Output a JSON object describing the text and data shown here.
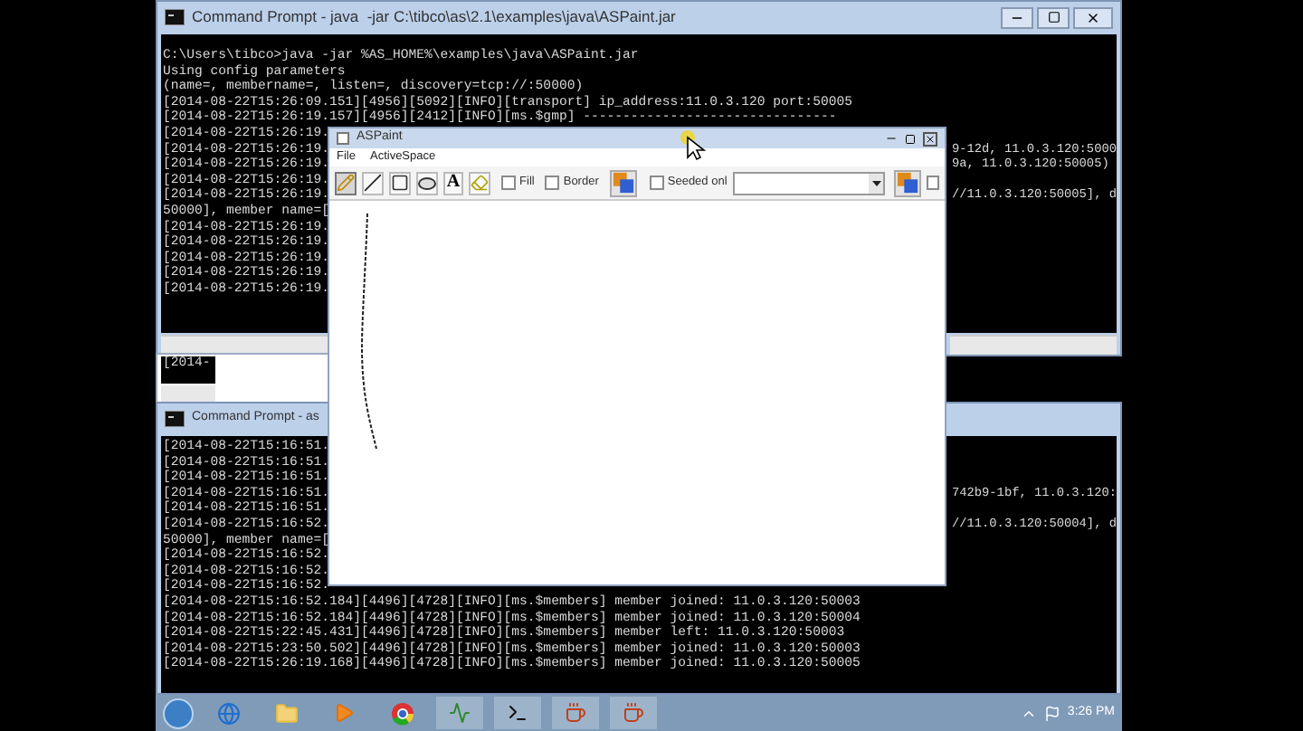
{
  "console_top": {
    "title": "Command Prompt - java  -jar C:\\tibco\\as\\2.1\\examples\\java\\ASPaint.jar",
    "lines": [
      {
        "text": "C:\\Users\\tibco>java -jar %AS_HOME%\\examples\\java\\ASPaint.jar"
      },
      {
        "text": "Using config parameters"
      },
      {
        "text": "(name=, membername=, listen=, discovery=tcp://:50000)"
      },
      {
        "text": "[2014-08-22T15:26:09.151][4956][5092][INFO][transport] ip_address:11.0.3.120 port:50005"
      },
      {
        "text": "[2014-08-22T15:26:19.157][4956][2412][INFO][ms.$gmp] --------------------------------"
      },
      {
        "text": "[2014-08-22T15:26:19."
      },
      {
        "text": "[2014-08-22T15:26:19.",
        "tail": "9-12d, 11.0.3.120:5000"
      },
      {
        "text": "[2014-08-22T15:26:19.",
        "tail": "9a, 11.0.3.120:50005)"
      },
      {
        "text": "[2014-08-22T15:26:19."
      },
      {
        "text": "[2014-08-22T15:26:19.",
        "tail": "//11.0.3.120:50005], d"
      },
      {
        "text": "50000], member name=["
      },
      {
        "text": "[2014-08-22T15:26:19."
      },
      {
        "text": "[2014-08-22T15:26:19."
      },
      {
        "text": "[2014-08-22T15:26:19."
      },
      {
        "text": "[2014-08-22T15:26:19."
      },
      {
        "text": "[2014-08-22T15:26:19."
      }
    ]
  },
  "console_middle": {
    "lines": [
      {
        "text": "[2014-"
      }
    ]
  },
  "console_bottom": {
    "title": "Command Prompt - as",
    "lines": [
      {
        "text": "[2014-08-22T15:16:51."
      },
      {
        "text": "[2014-08-22T15:16:51."
      },
      {
        "text": "[2014-08-22T15:16:51."
      },
      {
        "text": "[2014-08-22T15:16:51.",
        "tail": "742b9-1bf, 11.0.3.120:"
      },
      {
        "text": "[2014-08-22T15:16:51."
      },
      {
        "text": "[2014-08-22T15:16:52.",
        "tail": "//11.0.3.120:50004], d"
      },
      {
        "text": "50000], member name=["
      },
      {
        "text": "[2014-08-22T15:16:52."
      },
      {
        "text": "[2014-08-22T15:16:52."
      },
      {
        "text": "[2014-08-22T15:16:52."
      },
      {
        "text": "[2014-08-22T15:16:52.184][4496][4728][INFO][ms.$members] member joined: 11.0.3.120:50003"
      },
      {
        "text": "[2014-08-22T15:16:52.184][4496][4728][INFO][ms.$members] member joined: 11.0.3.120:50004"
      },
      {
        "text": "[2014-08-22T15:22:45.431][4496][4728][INFO][ms.$members] member left: 11.0.3.120:50003"
      },
      {
        "text": "[2014-08-22T15:23:50.502][4496][4728][INFO][ms.$members] member joined: 11.0.3.120:50003"
      },
      {
        "text": "[2014-08-22T15:26:19.168][4496][4728][INFO][ms.$members] member joined: 11.0.3.120:50005"
      }
    ]
  },
  "paint": {
    "title": "ASPaint",
    "menu": [
      "File",
      "ActiveSpace"
    ],
    "tools": [
      {
        "kind": "pencil",
        "selected": true
      },
      {
        "kind": "line",
        "selected": false
      },
      {
        "kind": "rectangle",
        "selected": false
      },
      {
        "kind": "oval",
        "selected": false
      },
      {
        "kind": "text",
        "label": "A",
        "selected": false
      },
      {
        "kind": "eraser",
        "selected": false
      }
    ],
    "options": [
      {
        "label": "Fill",
        "checked": false
      },
      {
        "label": "Border",
        "checked": false
      }
    ],
    "seeded": {
      "label": "Seeded onl",
      "checked": false
    },
    "extra_checkbox": {
      "checked": false
    }
  },
  "taskbar": {
    "clock": "3:26 PM"
  }
}
